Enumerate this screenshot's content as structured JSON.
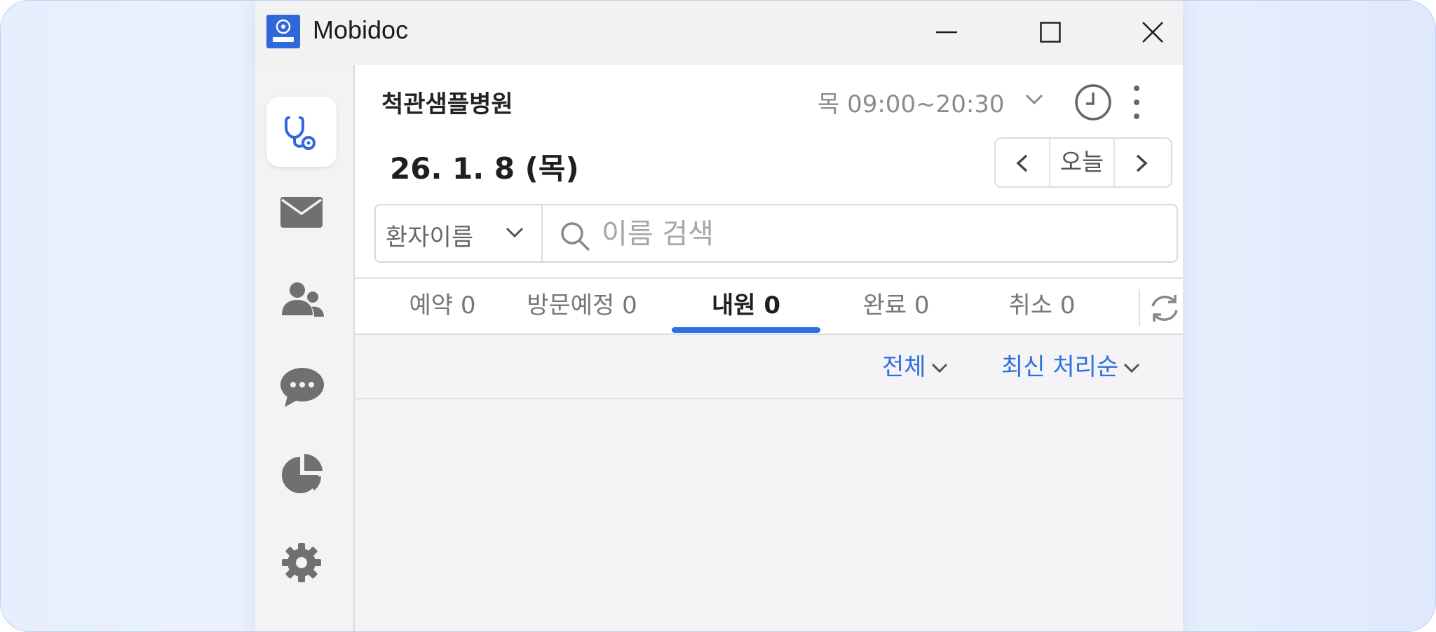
{
  "window": {
    "title": "Mobidoc",
    "minimize_icon": "minimize-icon",
    "maximize_icon": "maximize-icon",
    "close_icon": "close-icon"
  },
  "sidebar": {
    "items": [
      {
        "name": "stethoscope-icon",
        "active": true
      },
      {
        "name": "mail-icon",
        "active": false
      },
      {
        "name": "users-icon",
        "active": false
      },
      {
        "name": "chat-icon",
        "active": false
      },
      {
        "name": "pie-chart-icon",
        "active": false
      },
      {
        "name": "gear-icon",
        "active": false
      }
    ]
  },
  "header": {
    "hospital_name": "척관샘플병원",
    "hours": "목 09:00~20:30",
    "date": "26. 1. 8 (목)",
    "today_label": "오늘"
  },
  "search": {
    "type_label": "환자이름",
    "placeholder": "이름 검색"
  },
  "tabs": [
    {
      "label": "예약 0",
      "active": false
    },
    {
      "label": "방문예정 0",
      "active": false
    },
    {
      "label": "내원 0",
      "active": true
    },
    {
      "label": "완료 0",
      "active": false
    },
    {
      "label": "취소 0",
      "active": false
    }
  ],
  "filters": {
    "scope_label": "전체",
    "sort_label": "최신 처리순"
  },
  "colors": {
    "accent": "#2d6fe0",
    "sidebar_icon": "#707070",
    "active_icon": "#3468d8"
  }
}
